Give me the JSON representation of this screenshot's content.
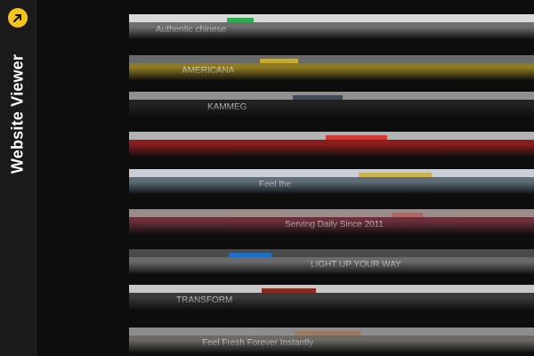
{
  "app": {
    "title": "Website Viewer",
    "logo_icon": "yellow-circle-arrow-icon",
    "accent_color": "#f4c21c"
  },
  "thumbnails": [
    {
      "name": "site-1",
      "label": "Authentic chinese",
      "top_color": "#d9d9d9",
      "strip_color": "#6f6f6f",
      "accent": "#2fae4f"
    },
    {
      "name": "site-2",
      "label": "AMERICANA",
      "top_color": "#6a6a6a",
      "strip_color": "#8e7a22",
      "accent": "#c7a93a"
    },
    {
      "name": "site-3",
      "label": "KAMMEG",
      "top_color": "#909090",
      "strip_color": "#222",
      "accent": "#3b4b5e"
    },
    {
      "name": "site-4",
      "label": "",
      "top_color": "#b3b3b3",
      "strip_color": "#8a1d1d",
      "accent": "#d13a34"
    },
    {
      "name": "site-5",
      "label": "Feel the",
      "top_color": "#c9ced6",
      "strip_color": "#5f6d79",
      "accent": "#c9b34d"
    },
    {
      "name": "site-6",
      "label": "Serving Daily Since 2011",
      "top_color": "#9a8c86",
      "strip_color": "#6a2f3a",
      "accent": "#b86262"
    },
    {
      "name": "site-7",
      "label": "LIGHT UP YOUR WAY",
      "top_color": "#4a4a4a",
      "strip_color": "#6b6b6b",
      "accent": "#1b6fc9"
    },
    {
      "name": "site-8",
      "label": "TRANSFORM",
      "top_color": "#c7c7c7",
      "strip_color": "#3a3a3a",
      "accent": "#8a2b22"
    },
    {
      "name": "site-9",
      "label": "Feel Fresh Forever Instantly",
      "top_color": "#8d8d8d",
      "strip_color": "#6d6a66",
      "accent": "#9b7a62"
    }
  ]
}
